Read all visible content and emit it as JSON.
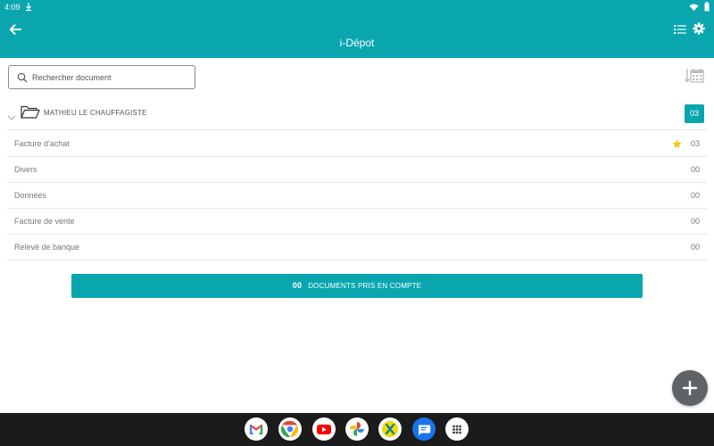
{
  "status_bar": {
    "time": "4:09"
  },
  "app_bar": {
    "title": "i-Dépot"
  },
  "search": {
    "placeholder": "Rechercher document"
  },
  "folder": {
    "name": "MATHIEU LE CHAUFFAGISTE",
    "count": "03"
  },
  "categories": [
    {
      "label": "Facture d'achat",
      "count": "03",
      "starred": true
    },
    {
      "label": "Divers",
      "count": "00"
    },
    {
      "label": "Données",
      "count": "00"
    },
    {
      "label": "Facture de vente",
      "count": "00"
    },
    {
      "label": "Relevé de banque",
      "count": "00"
    }
  ],
  "documents_button": {
    "count": "00",
    "label": "DOCUMENTS PRIS EN COMPTE"
  },
  "colors": {
    "accent": "#0aa6b0",
    "star": "#f5c518",
    "fab": "#5f6368",
    "taskbar": "#1b1b1b"
  },
  "taskbar_apps": [
    "gmail-icon",
    "chrome-icon",
    "youtube-icon",
    "photos-icon",
    "app-x-icon",
    "messages-icon",
    "app-drawer-icon"
  ]
}
